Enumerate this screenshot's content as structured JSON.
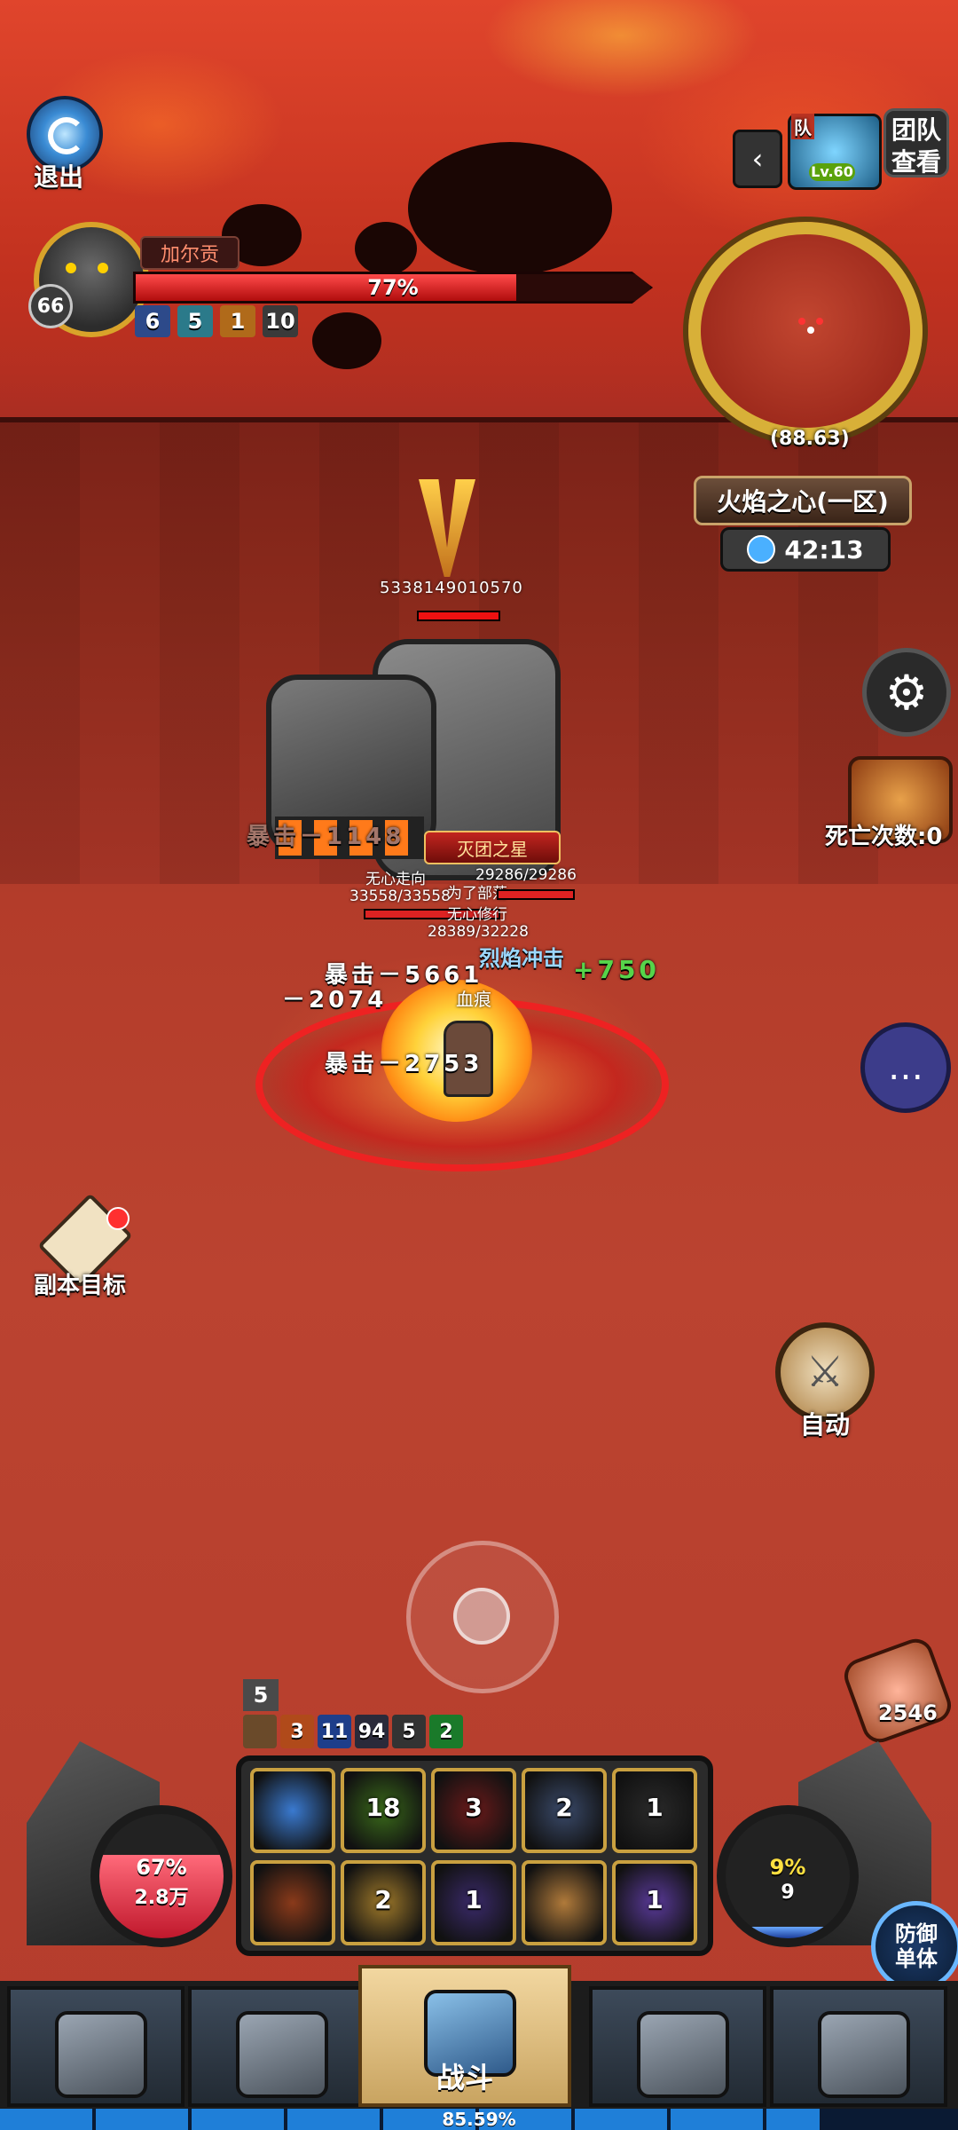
{
  "top_left": {
    "exit_label": "退出"
  },
  "boss": {
    "name": "加尔贡",
    "level": "66",
    "hp_percent_text": "77%",
    "hp_fraction": 0.77,
    "buffs": [
      {
        "value": "6",
        "color": "#2d4a8a"
      },
      {
        "value": "5",
        "color": "#2b7a8a"
      },
      {
        "value": "1",
        "color": "#b06a1a"
      },
      {
        "value": "10",
        "color": "#3a3a3a"
      }
    ]
  },
  "top_right": {
    "collapse_icon": "chevron-left-icon",
    "team_tag": "队",
    "team_level": "Lv.60",
    "team_view_line1": "团队",
    "team_view_line2": "查看"
  },
  "minimap": {
    "coordinate": "(88.63)",
    "zone_name": "火焰之心(一区)",
    "timer": "42:13"
  },
  "right_side": {
    "settings_icon": "gear-icon",
    "death_count_label": "死亡次数:0",
    "chat_icon": "chat-bubble-icon",
    "auto_label": "自动",
    "food_count": "2546"
  },
  "left_side": {
    "quest_label": "副本目标"
  },
  "battle": {
    "boss_hp_numbers": "5338149010570",
    "title_tag": "灭团之星",
    "floating_texts": {
      "crit_grey": "暴击－1148",
      "hp_a": "无心走向",
      "hp_b": "29286/29286",
      "hp_c": "33558/33558",
      "hp_d": "为了部落",
      "hp_e": "无心修行",
      "hp_f": "28389/32228",
      "skill_name": "烈焰冲击",
      "heal": "+750",
      "crit1": "暴击－5661",
      "dmg1": "－2074",
      "bleed": "血痕",
      "crit2": "暴击－2753"
    }
  },
  "bottom": {
    "stack_top": "5",
    "stacks": [
      {
        "value": "",
        "color": "#6a4a2a"
      },
      {
        "value": "3",
        "color": "#b04a1a"
      },
      {
        "value": "11",
        "color": "#1e3e8a"
      },
      {
        "value": "94",
        "color": "#2a2a3a"
      },
      {
        "value": "5",
        "color": "#333333"
      },
      {
        "value": "2",
        "color": "#1a7a2a"
      }
    ],
    "hp_orb": {
      "percent": "67%",
      "value": "2.8万",
      "fraction": 0.67
    },
    "mp_orb": {
      "percent": "9%",
      "value": "9",
      "fraction": 0.09
    },
    "skills": [
      {
        "icon": "shield-icon",
        "count": "",
        "color": "#3a7ad0"
      },
      {
        "icon": "flame-fist-icon",
        "count": "18",
        "color": "#3a6a1a"
      },
      {
        "icon": "claw-icon",
        "count": "3",
        "color": "#6a1a1a"
      },
      {
        "icon": "winged-blade-icon",
        "count": "2",
        "color": "#3a4a6a"
      },
      {
        "icon": "shadow-icon",
        "count": "1",
        "color": "#2a2a2a"
      },
      {
        "icon": "beast-icon",
        "count": "",
        "color": "#8a3a1a"
      },
      {
        "icon": "golden-shield-icon",
        "count": "2",
        "color": "#a07a2a"
      },
      {
        "icon": "dark-slash-icon",
        "count": "1",
        "color": "#3a2a6a"
      },
      {
        "icon": "golem-icon",
        "count": "",
        "color": "#b07a3a"
      },
      {
        "icon": "mirror-icon",
        "count": "1",
        "color": "#5a3a9a"
      }
    ],
    "defense_line1": "防御",
    "defense_line2": "单体",
    "tabs": [
      {
        "icon": "stone-rune-icon",
        "label": ""
      },
      {
        "icon": "hooded-mage-icon",
        "label": ""
      },
      {
        "icon": "battle-emblem-icon",
        "label": "战斗"
      },
      {
        "icon": "temple-icon",
        "label": ""
      },
      {
        "icon": "castle-icon",
        "label": ""
      }
    ],
    "exp_text": "85.59%",
    "exp_fraction": 0.8559
  }
}
